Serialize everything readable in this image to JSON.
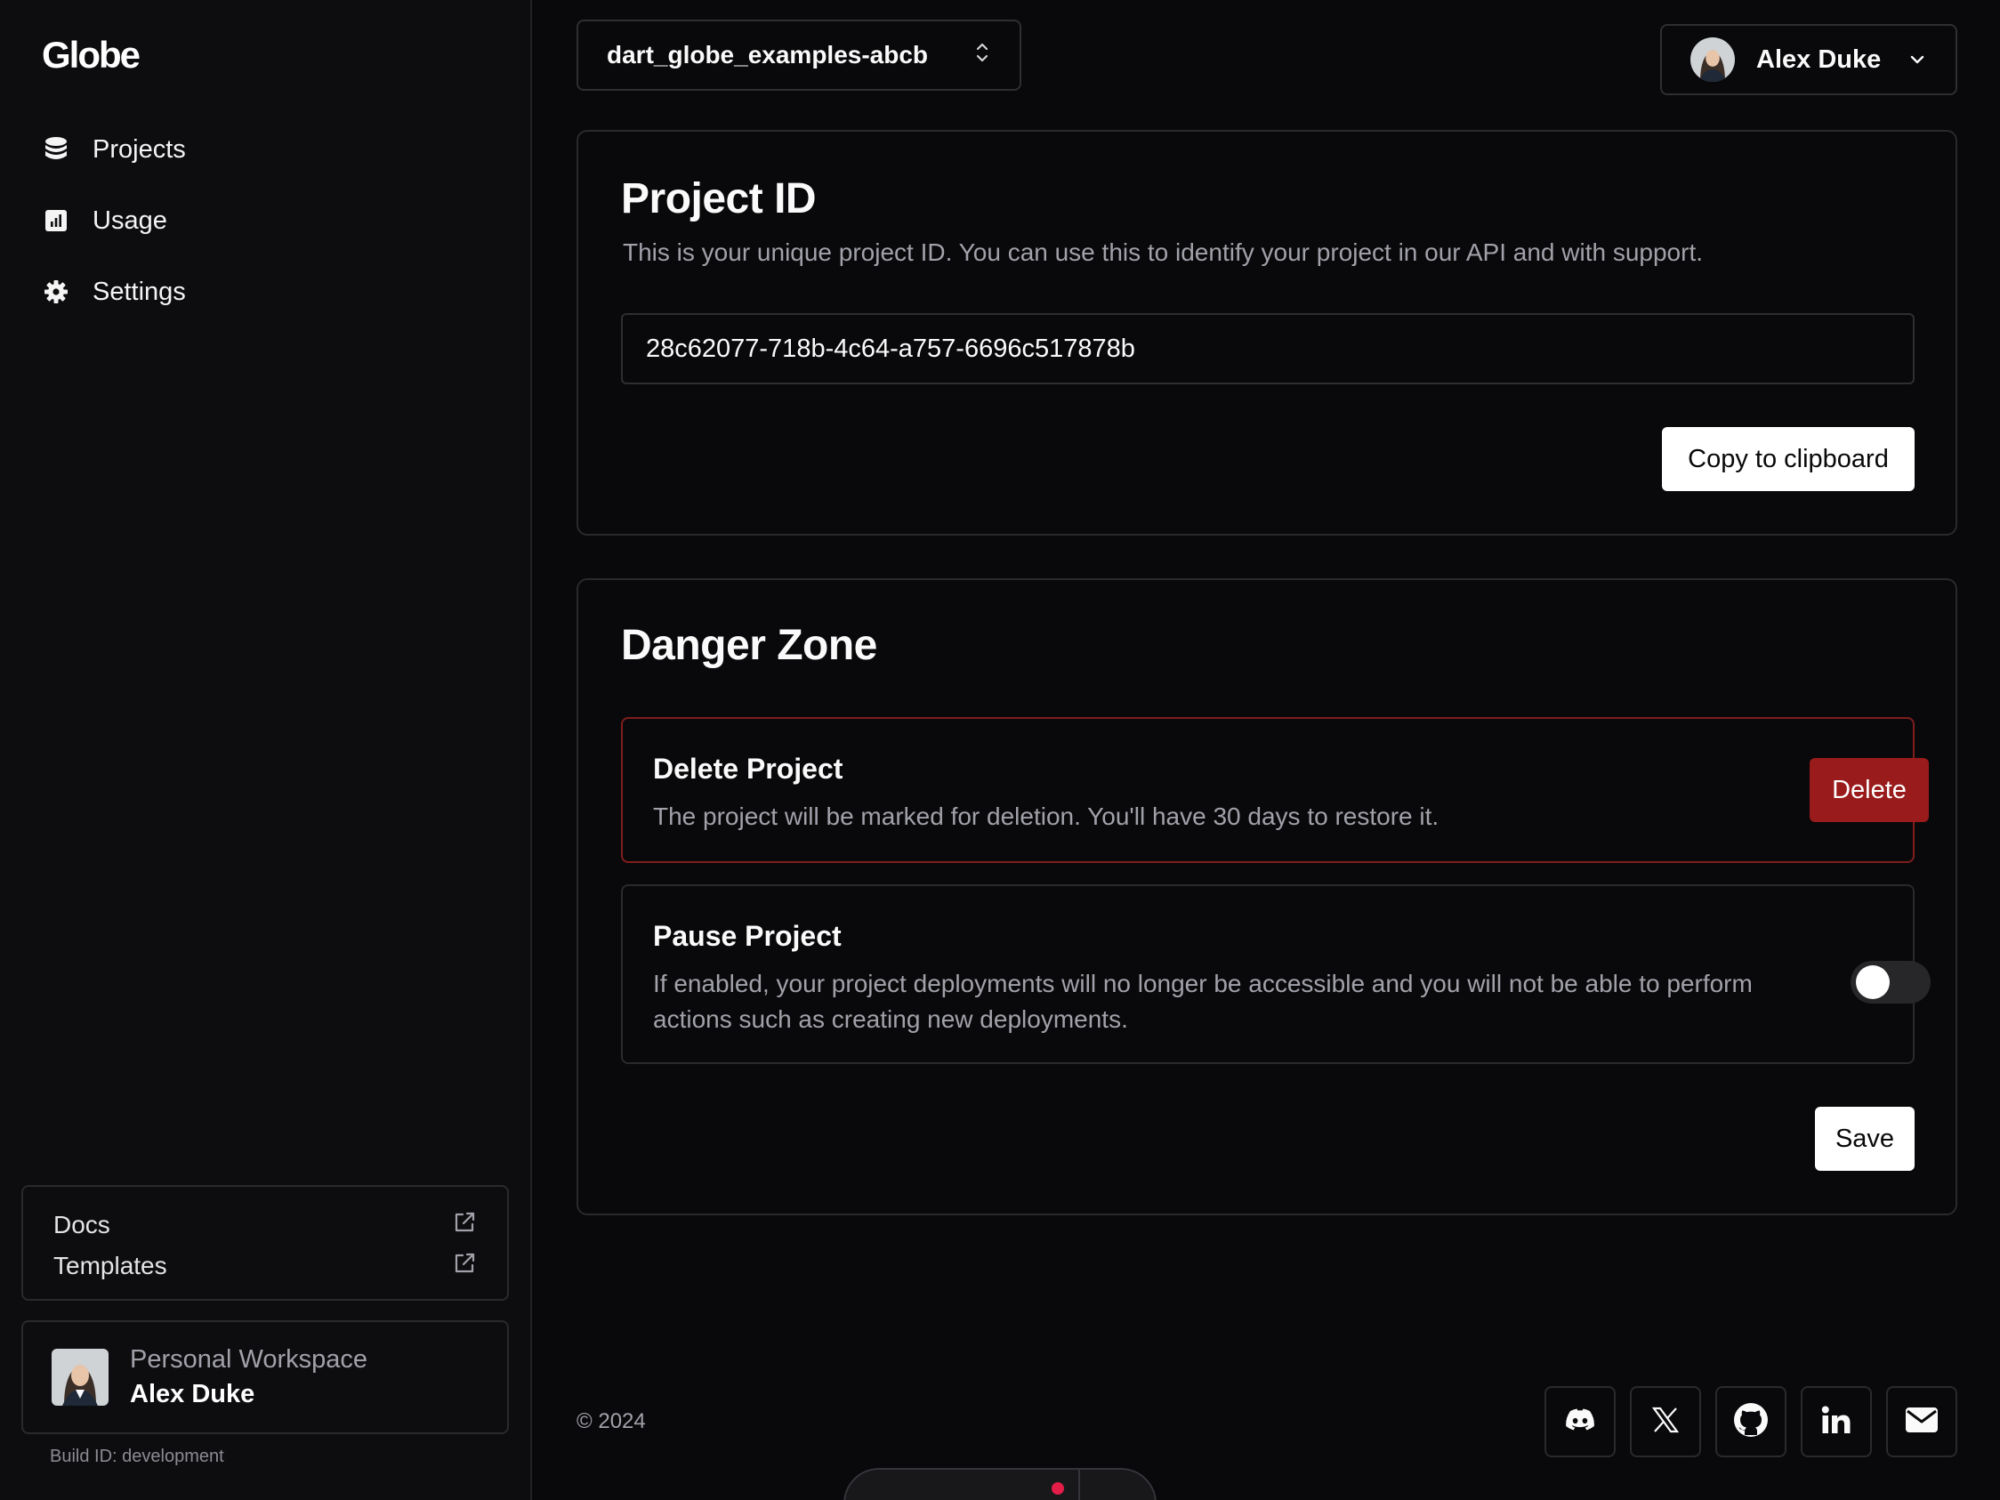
{
  "sidebar": {
    "logo": "Globe",
    "nav": [
      {
        "label": "Projects",
        "icon": "database-icon"
      },
      {
        "label": "Usage",
        "icon": "bar-chart-icon"
      },
      {
        "label": "Settings",
        "icon": "gear-icon"
      }
    ],
    "links": [
      {
        "label": "Docs",
        "icon": "external-link-icon"
      },
      {
        "label": "Templates",
        "icon": "external-link-icon"
      }
    ],
    "workspace": {
      "label": "Personal Workspace",
      "name": "Alex Duke"
    },
    "build_id": "Build ID: development"
  },
  "header": {
    "project_selector": "dart_globe_examples-abcb",
    "user_name": "Alex Duke"
  },
  "project_id_card": {
    "title": "Project ID",
    "description": "This is your unique project ID. You can use this to identify your project in our API and with support.",
    "project_id": "28c62077-718b-4c64-a757-6696c517878b",
    "copy_label": "Copy to clipboard"
  },
  "danger_zone": {
    "title": "Danger Zone",
    "delete": {
      "title": "Delete Project",
      "description": "The project will be marked for deletion. You'll have 30 days to restore it.",
      "button": "Delete"
    },
    "pause": {
      "title": "Pause Project",
      "description": "If enabled, your project deployments will no longer be accessible and you will not be able to perform actions such as creating new deployments.",
      "enabled": false
    },
    "save_label": "Save"
  },
  "footer": {
    "copyright": "© 2024",
    "socials": [
      "discord-icon",
      "x-icon",
      "github-icon",
      "linkedin-icon",
      "mail-icon"
    ]
  },
  "colors": {
    "background": "#09090b",
    "danger": "#991b1b",
    "danger_border": "#7f1d1d",
    "muted_text": "#a1a1aa"
  }
}
